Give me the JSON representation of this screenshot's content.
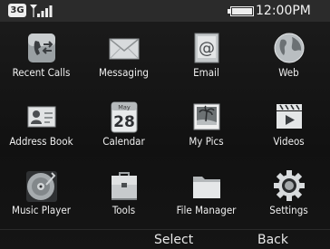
{
  "status_bar": {
    "network_badge": "3G",
    "signal_icon": "signal-bars-icon",
    "battery_icon": "battery-icon",
    "time": "12:00PM"
  },
  "apps": [
    {
      "label": "Recent Calls",
      "icon": "recent-calls-icon"
    },
    {
      "label": "Messaging",
      "icon": "envelope-icon"
    },
    {
      "label": "Email",
      "icon": "email-at-icon"
    },
    {
      "label": "Web",
      "icon": "globe-icon"
    },
    {
      "label": "Address Book",
      "icon": "address-book-icon"
    },
    {
      "label": "Calendar",
      "icon": "calendar-icon",
      "calendar_month": "May",
      "calendar_day": "28"
    },
    {
      "label": "My Pics",
      "icon": "photo-icon"
    },
    {
      "label": "Videos",
      "icon": "video-icon"
    },
    {
      "label": "Music Player",
      "icon": "music-disc-icon"
    },
    {
      "label": "Tools",
      "icon": "toolbox-icon"
    },
    {
      "label": "File Manager",
      "icon": "folder-icon"
    },
    {
      "label": "Settings",
      "icon": "gear-icon"
    }
  ],
  "softkeys": {
    "left": "Select",
    "right": "Back"
  },
  "colors": {
    "background": "#141414",
    "status_bar": "#2b2b2b",
    "text": "#f0f0f0"
  }
}
